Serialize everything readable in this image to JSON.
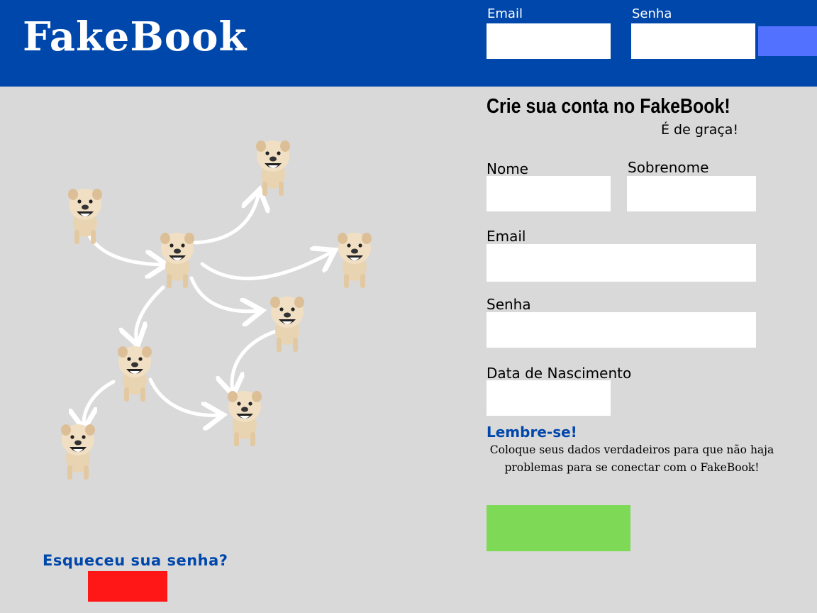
{
  "header": {
    "logo": "FakeBook",
    "email_label": "Email",
    "password_label": "Senha",
    "email_value": "",
    "password_value": ""
  },
  "signup": {
    "title": "Crie sua conta no FakeBook!",
    "subtitle": "É de graça!",
    "first_name_label": "Nome",
    "last_name_label": "Sobrenome",
    "email_label": "Email",
    "password_label": "Senha",
    "birthdate_label": "Data de Nascimento",
    "first_name_value": "",
    "last_name_value": "",
    "email_value": "",
    "password_value": "",
    "birthdate_value": ""
  },
  "reminder": {
    "title": "Lembre-se!",
    "text": "Coloque seus dados verdadeiros para que não haja problemas para se conectar com o FakeBook!"
  },
  "forgot": {
    "title": "Esqueceu sua senha?"
  },
  "colors": {
    "header_bg": "#0047ab",
    "page_bg": "#d9d9d9",
    "login_button": "#5271ff",
    "submit_button": "#7ed957",
    "forgot_button": "#ff1616",
    "accent_text": "#0047ab"
  }
}
